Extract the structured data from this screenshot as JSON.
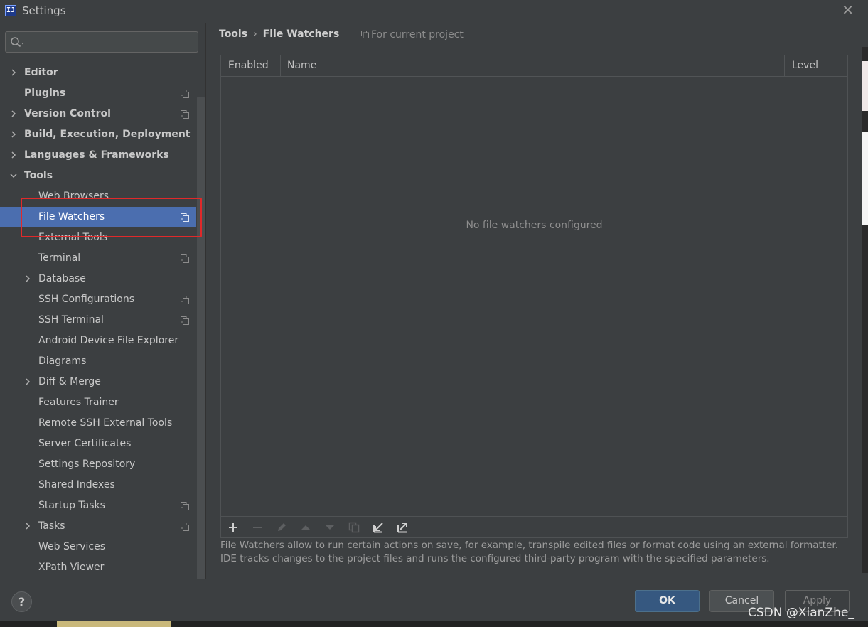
{
  "window": {
    "title": "Settings"
  },
  "search": {
    "placeholder": "",
    "value": ""
  },
  "sidebar": {
    "items": [
      {
        "label": "Editor",
        "level": 0,
        "expandable": true,
        "expanded": false,
        "bold": true,
        "project_icon": false
      },
      {
        "label": "Plugins",
        "level": 0,
        "expandable": false,
        "bold": true,
        "project_icon": true
      },
      {
        "label": "Version Control",
        "level": 0,
        "expandable": true,
        "expanded": false,
        "bold": true,
        "project_icon": true
      },
      {
        "label": "Build, Execution, Deployment",
        "level": 0,
        "expandable": true,
        "expanded": false,
        "bold": true,
        "project_icon": false
      },
      {
        "label": "Languages & Frameworks",
        "level": 0,
        "expandable": true,
        "expanded": false,
        "bold": true,
        "project_icon": false
      },
      {
        "label": "Tools",
        "level": 0,
        "expandable": true,
        "expanded": true,
        "bold": true,
        "project_icon": false
      },
      {
        "label": "Web Browsers",
        "level": 1,
        "expandable": false,
        "project_icon": false
      },
      {
        "label": "File Watchers",
        "level": 1,
        "expandable": false,
        "project_icon": true,
        "selected": true
      },
      {
        "label": "External Tools",
        "level": 1,
        "expandable": false,
        "project_icon": false
      },
      {
        "label": "Terminal",
        "level": 1,
        "expandable": false,
        "project_icon": true
      },
      {
        "label": "Database",
        "level": 1,
        "expandable": true,
        "expanded": false,
        "project_icon": false
      },
      {
        "label": "SSH Configurations",
        "level": 1,
        "expandable": false,
        "project_icon": true
      },
      {
        "label": "SSH Terminal",
        "level": 1,
        "expandable": false,
        "project_icon": true
      },
      {
        "label": "Android Device File Explorer",
        "level": 1,
        "expandable": false,
        "project_icon": false
      },
      {
        "label": "Diagrams",
        "level": 1,
        "expandable": false,
        "project_icon": false
      },
      {
        "label": "Diff & Merge",
        "level": 1,
        "expandable": true,
        "expanded": false,
        "project_icon": false
      },
      {
        "label": "Features Trainer",
        "level": 1,
        "expandable": false,
        "project_icon": false
      },
      {
        "label": "Remote SSH External Tools",
        "level": 1,
        "expandable": false,
        "project_icon": false
      },
      {
        "label": "Server Certificates",
        "level": 1,
        "expandable": false,
        "project_icon": false
      },
      {
        "label": "Settings Repository",
        "level": 1,
        "expandable": false,
        "project_icon": false
      },
      {
        "label": "Shared Indexes",
        "level": 1,
        "expandable": false,
        "project_icon": false
      },
      {
        "label": "Startup Tasks",
        "level": 1,
        "expandable": false,
        "project_icon": true
      },
      {
        "label": "Tasks",
        "level": 1,
        "expandable": true,
        "expanded": false,
        "project_icon": true
      },
      {
        "label": "Web Services",
        "level": 1,
        "expandable": false,
        "project_icon": false
      },
      {
        "label": "XPath Viewer",
        "level": 1,
        "expandable": false,
        "project_icon": false
      }
    ]
  },
  "breadcrumb": {
    "parent": "Tools",
    "separator": "›",
    "current": "File Watchers"
  },
  "scope": {
    "label": "For current project"
  },
  "table": {
    "columns": [
      "Enabled",
      "Name",
      "Level"
    ],
    "empty_text": "No file watchers configured"
  },
  "toolbar": {
    "buttons": [
      {
        "icon": "plus-icon",
        "enabled": true
      },
      {
        "icon": "minus-icon",
        "enabled": false
      },
      {
        "icon": "edit-icon",
        "enabled": false
      },
      {
        "icon": "move-up-icon",
        "enabled": false
      },
      {
        "icon": "move-down-icon",
        "enabled": false
      },
      {
        "icon": "copy-icon",
        "enabled": false
      },
      {
        "icon": "import-icon",
        "enabled": true
      },
      {
        "icon": "export-icon",
        "enabled": true
      }
    ]
  },
  "description": {
    "line1": "File Watchers allow to run certain actions on save, for example, transpile edited files or format code using an external formatter.",
    "line2": "IDE tracks changes to the project files and runs the configured third-party program with the specified parameters."
  },
  "buttons": {
    "help": "?",
    "ok": "OK",
    "cancel": "Cancel",
    "apply": "Apply"
  },
  "watermark": "CSDN @XianZhe_",
  "colors": {
    "selection": "#4b6eaf",
    "highlight_box": "#e0292a",
    "ok_button": "#365880"
  }
}
